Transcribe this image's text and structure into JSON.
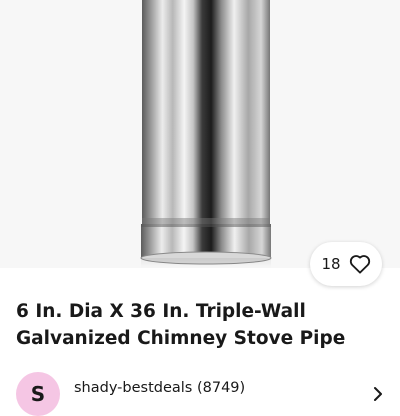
{
  "listing": {
    "watch_count": "18",
    "title": "6 In. Dia X 36 In. Triple-Wall Galvanized Chimney Stove Pipe"
  },
  "seller": {
    "avatar_letter": "S",
    "name_feedback": "shady-bestdeals (8749)"
  },
  "icons": {
    "watch": "heart-icon",
    "seller_nav": "chevron-right-icon"
  },
  "colors": {
    "hero_bg": "#f7f7f7",
    "avatar_bg": "#f5c6e4",
    "text": "#191919"
  }
}
